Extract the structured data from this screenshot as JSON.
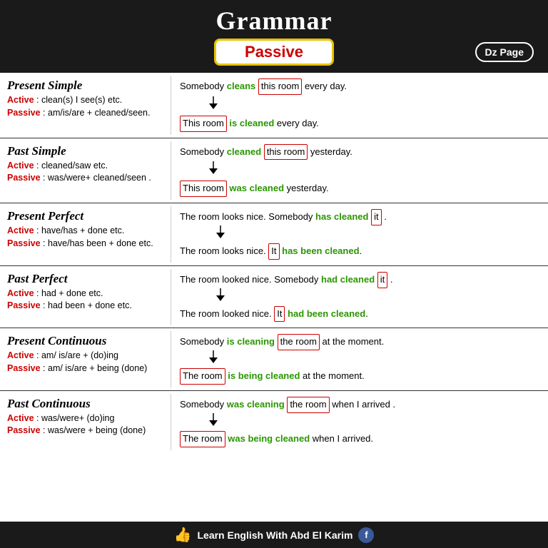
{
  "header": {
    "title": "Grammar",
    "passive_label": "Passive",
    "dz_page": "Dz Page"
  },
  "sections": [
    {
      "id": "present-simple",
      "title": "Present Simple",
      "active_label": "Active",
      "active_value": ": clean(s) I see(s) etc.",
      "passive_label": "Passive",
      "passive_value": ": am/is/are + cleaned/seen.",
      "example_active": "Somebody cleans this room every day.",
      "example_passive": "This room is cleaned every day."
    },
    {
      "id": "past-simple",
      "title": "Past Simple",
      "active_label": "Active",
      "active_value": ": cleaned/saw etc.",
      "passive_label": "Passive",
      "passive_value": ": was/were+ cleaned/seen .",
      "example_active": "Somebody cleaned this room yesterday.",
      "example_passive": "This room was cleaned yesterday."
    },
    {
      "id": "present-perfect",
      "title": "Present Perfect",
      "active_label": "Active",
      "active_value": ": have/has + done etc.",
      "passive_label": "Passive",
      "passive_value": ": have/has been + done etc.",
      "example_active": "The room looks nice. Somebody has cleaned it .",
      "example_passive": "The room looks nice. It has been cleaned."
    },
    {
      "id": "past-perfect",
      "title": "Past Perfect",
      "active_label": "Active",
      "active_value": ": had + done etc.",
      "passive_label": "Passive",
      "passive_value": ": had been + done etc.",
      "example_active": "The room looked nice. Somebody had cleaned it .",
      "example_passive": "The room looked nice. It had been cleaned."
    },
    {
      "id": "present-continuous",
      "title": "Present Continuous",
      "active_label": "Active",
      "active_value": ": am/ is/are + (do)ing",
      "passive_label": "Passive",
      "passive_value": ": am/ is/are + being (done)",
      "example_active": "Somebody is cleaning the room at the moment.",
      "example_passive": "The room is being cleaned at the moment."
    },
    {
      "id": "past-continuous",
      "title": "Past Continuous",
      "active_label": "Active",
      "active_value": ": was/were+ (do)ing",
      "passive_label": "Passive",
      "passive_value": ": was/were + being (done)",
      "example_active": "Somebody was cleaning the room when I arrived .",
      "example_passive": "The room was being cleaned when I arrived."
    }
  ],
  "footer": {
    "text": "Learn English With Abd El Karim"
  }
}
